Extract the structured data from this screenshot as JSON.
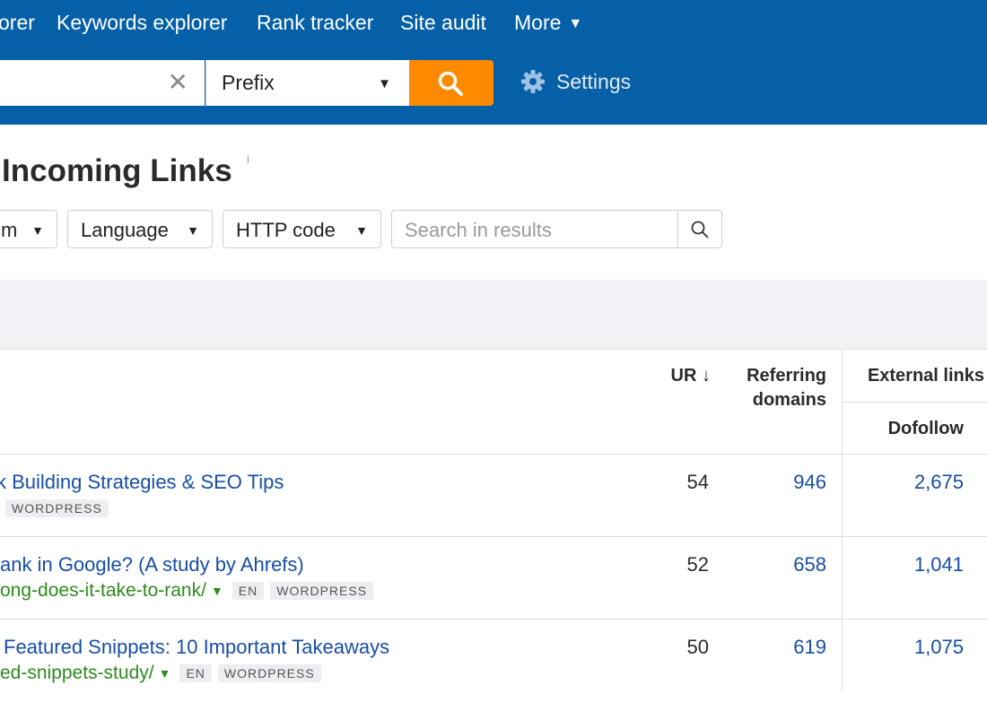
{
  "nav": {
    "items": [
      "orer",
      "Keywords explorer",
      "Rank tracker",
      "Site audit",
      "More"
    ]
  },
  "search": {
    "mode": "Prefix",
    "settings_label": "Settings"
  },
  "page": {
    "title": "Incoming Links",
    "info": "i"
  },
  "filters": {
    "partial": "m",
    "language": "Language",
    "http_code": "HTTP code",
    "search_placeholder": "Search in results"
  },
  "table": {
    "headers": {
      "ur": "UR",
      "ur_sort": "↓",
      "referring_line1": "Referring",
      "referring_line2": "domains",
      "external": "External links",
      "dofollow": "Dofollow"
    },
    "rows": [
      {
        "title": "k Building Strategies & SEO Tips",
        "url": "",
        "tags": [
          "WORDPRESS"
        ],
        "ur": "54",
        "rd": "946",
        "ext": "2,675"
      },
      {
        "title": "ank in Google? (A study by Ahrefs)",
        "url": "ong-does-it-take-to-rank/",
        "tags": [
          "EN",
          "WORDPRESS"
        ],
        "ur": "52",
        "rd": "658",
        "ext": "1,041"
      },
      {
        "title": "Featured Snippets: 10 Important Takeaways",
        "url": "ed-snippets-study/",
        "tags": [
          "EN",
          "WORDPRESS"
        ],
        "ur": "50",
        "rd": "619",
        "ext": "1,075"
      }
    ]
  },
  "colors": {
    "topbar": "#0560a8",
    "accent": "#ff8a00",
    "link": "#174ea6",
    "url_green": "#2e8b1e"
  }
}
